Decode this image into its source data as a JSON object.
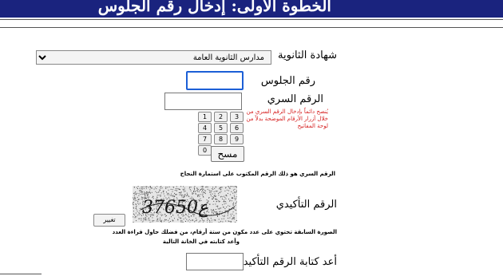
{
  "header": {
    "title": "الخطوة الأولى: إدخال رقم الجلوس"
  },
  "form": {
    "certificate_label": "شهادة الثانوية",
    "certificate_value": "مدارس الثانوية العامة",
    "seat_label": "رقم الجلوس",
    "seat_value": "",
    "secret_label": "الرقم السري",
    "secret_value": "",
    "secret_note": "يُنصح دائماً بإدخال الرقم السري من خلال أزرار الأرقام الموضحة بدلاً من لوحة المفاتيح",
    "keypad": [
      "1",
      "2",
      "3",
      "4",
      "5",
      "6",
      "7",
      "8",
      "9",
      "0"
    ],
    "clear_label": "مسح",
    "secret_hint": "الرقم السري هو ذلك الرقم المكتوب على استمارة النجاح",
    "captcha_label": "الرقم التأكيدي",
    "captcha_text": "37ع650",
    "change_label": "تغيير",
    "captcha_note_1": "الصورة السابقة تحتوي على عدد مكون من ستة أرقام، من فضلك حاول قراءة العدد",
    "captcha_note_2": "وأعد كتابته في الخانة التالية",
    "retype_label": "أعد كتابة الرقم التأكيدي",
    "retype_value": ""
  },
  "colors": {
    "header_bg": "#1a237e",
    "note_red": "#d62020",
    "focus_blue": "#1c5fd6"
  }
}
